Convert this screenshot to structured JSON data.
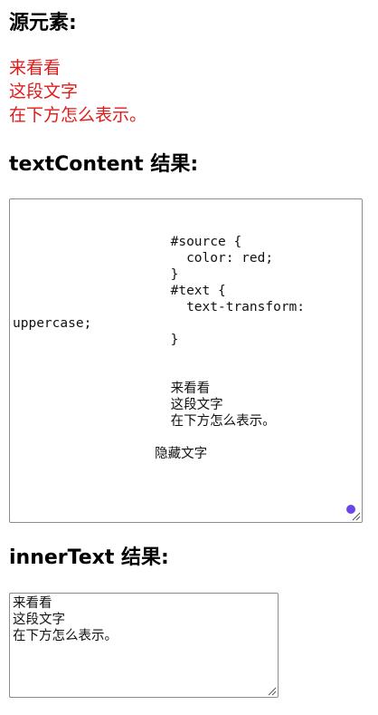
{
  "source_section": {
    "heading": "源元素:",
    "lines": [
      "来看看",
      "这段文字",
      "在下方怎么表示。"
    ]
  },
  "text_content_section": {
    "heading": "textContent 结果:",
    "value": "\n\n                    #source {\n                      color: red;\n                    }\n                    #text {\n                      text-transform:\nuppercase;\n                    }\n\n\n                    来看看\n                    这段文字\n                    在下方怎么表示。\n\n                  隐藏文字"
  },
  "inner_text_section": {
    "heading": "innerText 结果:",
    "value": "来看看\n这段文字\n在下方怎么表示。"
  },
  "colors": {
    "source_text": "#e11b1b",
    "indicator_dot": "#6a46ea"
  }
}
